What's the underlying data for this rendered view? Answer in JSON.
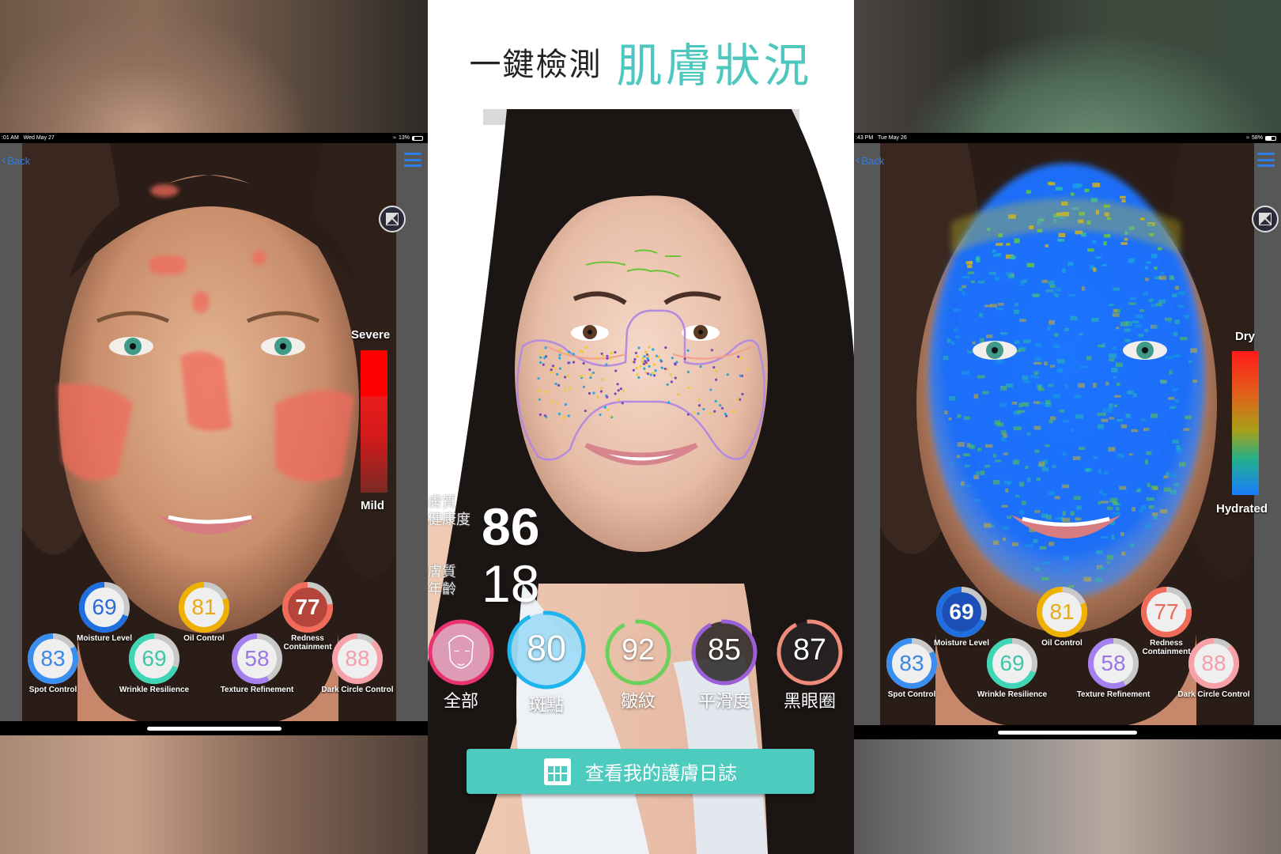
{
  "colors": {
    "teal_accent": "#4ecbbf",
    "ios_blue": "#2f7ee8",
    "redness_severe": "#ff0000",
    "moisture_dry": "#ff1a1a",
    "moisture_hydrated": "#1a7cff"
  },
  "left_ipad": {
    "status_time": ":01 AM",
    "status_date": "Wed May 27",
    "battery": "13%",
    "battery_level": 0.13,
    "back_label": "Back",
    "icons": [
      "chevron-left-icon",
      "hamburger-menu-icon",
      "compare-icon",
      "wifi-icon",
      "battery-icon"
    ],
    "legend": {
      "top": "Severe",
      "bottom": "Mild"
    },
    "scores": [
      {
        "label": "Moisture Level",
        "value": "69",
        "ratio": 0.69,
        "color": "#1f6fe0",
        "text_color": "#2a6ad6",
        "fill": "#efefef"
      },
      {
        "label": "Oil Control",
        "value": "81",
        "ratio": 0.81,
        "color": "#f0b000",
        "text_color": "#e6a91a",
        "fill": "#efefef"
      },
      {
        "label": "Redness Containment",
        "value": "77",
        "ratio": 0.77,
        "color": "#f26a58",
        "text_color": "#ffffff",
        "fill": "#b5453a"
      },
      {
        "label": "Spot Control",
        "value": "83",
        "ratio": 0.83,
        "color": "#3a8ef0",
        "text_color": "#3a86e6",
        "fill": "#efefef"
      },
      {
        "label": "Wrinkle Resilience",
        "value": "69",
        "ratio": 0.69,
        "color": "#3fd6b5",
        "text_color": "#3fc6a8",
        "fill": "#efefef"
      },
      {
        "label": "Texture Refinement",
        "value": "58",
        "ratio": 0.58,
        "color": "#a67ff0",
        "text_color": "#9d76e6",
        "fill": "#efefef"
      },
      {
        "label": "Dark Circle Control",
        "value": "88",
        "ratio": 0.88,
        "color": "#f6a0a8",
        "text_color": "#f2a0aa",
        "fill": "#efefef"
      }
    ]
  },
  "right_ipad": {
    "status_time": ":43 PM",
    "status_date": "Tue May 26",
    "battery": "58%",
    "battery_level": 0.58,
    "back_label": "Back",
    "icons": [
      "chevron-left-icon",
      "hamburger-menu-icon",
      "compare-icon",
      "wifi-icon",
      "battery-icon"
    ],
    "legend": {
      "top": "Dry",
      "bottom": "Hydrated"
    },
    "scores": [
      {
        "label": "Moisture Level",
        "value": "69",
        "ratio": 0.69,
        "color": "#1f6fe0",
        "text_color": "#ffffff",
        "fill": "#1d4fb8"
      },
      {
        "label": "Oil Control",
        "value": "81",
        "ratio": 0.81,
        "color": "#f0b000",
        "text_color": "#e6a91a",
        "fill": "#efefef"
      },
      {
        "label": "Redness Containment",
        "value": "77",
        "ratio": 0.77,
        "color": "#f26a58",
        "text_color": "#e86a5c",
        "fill": "#efefef"
      },
      {
        "label": "Spot Control",
        "value": "83",
        "ratio": 0.83,
        "color": "#3a8ef0",
        "text_color": "#3a86e6",
        "fill": "#efefef"
      },
      {
        "label": "Wrinkle Resilience",
        "value": "69",
        "ratio": 0.69,
        "color": "#3fd6b5",
        "text_color": "#3fc6a8",
        "fill": "#efefef"
      },
      {
        "label": "Texture Refinement",
        "value": "58",
        "ratio": 0.58,
        "color": "#a67ff0",
        "text_color": "#9d76e6",
        "fill": "#efefef"
      },
      {
        "label": "Dark Circle Control",
        "value": "88",
        "ratio": 0.88,
        "color": "#f6a0a8",
        "text_color": "#f2a0aa",
        "fill": "#efefef"
      }
    ]
  },
  "center_phone": {
    "headline_prefix": "一鍵檢測",
    "headline_highlight": "肌膚狀況",
    "skin_health_label_1": "膚質",
    "skin_health_label_2": "健康度",
    "skin_health_value": "86",
    "skin_age_label_1": "膚質",
    "skin_age_label_2": "年齡",
    "skin_age_value": "18",
    "categories": [
      {
        "label": "全部",
        "value": "",
        "icon": "face-outline-icon",
        "ratio": 1.0,
        "color": "#e8336f",
        "fill": "rgba(244,170,200,0.9)"
      },
      {
        "label": "斑點",
        "value": "80",
        "ratio": 0.8,
        "color": "#1fb4ec",
        "fill": "rgba(160,220,245,0.95)"
      },
      {
        "label": "皺紋",
        "value": "92",
        "ratio": 0.92,
        "color": "#6cd15a",
        "fill": "rgba(0,0,0,0)"
      },
      {
        "label": "平滑度",
        "value": "85",
        "ratio": 0.85,
        "color": "#9b5fd8",
        "fill": "rgba(40,36,36,0.85)"
      },
      {
        "label": "黑眼圈",
        "value": "87",
        "ratio": 0.87,
        "color": "#f08a7a",
        "fill": "rgba(40,36,36,0.85)"
      }
    ],
    "diary_button_label": "查看我的護膚日誌",
    "diary_icon": "calendar-icon"
  }
}
